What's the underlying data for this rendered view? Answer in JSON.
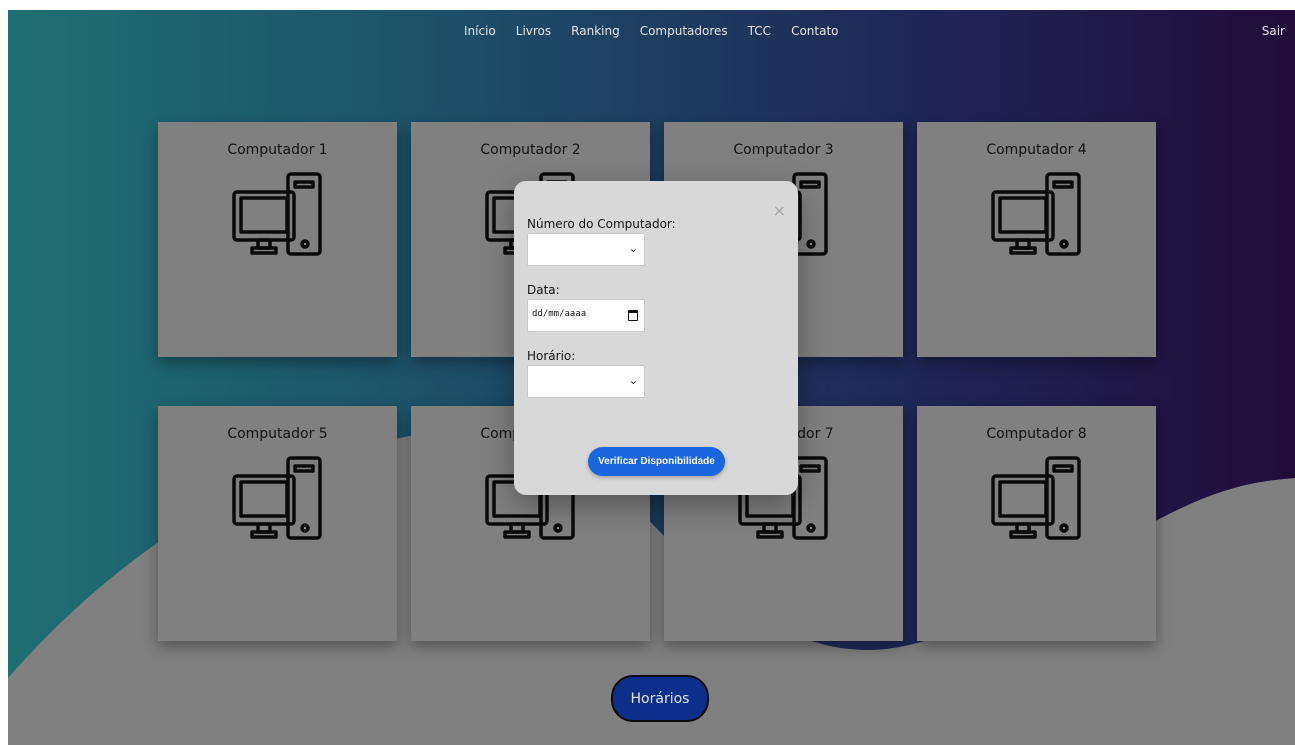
{
  "nav": {
    "items": [
      "Início",
      "Livros",
      "Ranking",
      "Computadores",
      "TCC",
      "Contato"
    ],
    "logout": "Sair"
  },
  "computers": [
    {
      "title": "Computador 1",
      "icon": "desktop-computer-icon"
    },
    {
      "title": "Computador 2",
      "icon": "desktop-computer-icon"
    },
    {
      "title": "Computador 3",
      "icon": "desktop-computer-icon"
    },
    {
      "title": "Computador 4",
      "icon": "desktop-computer-icon"
    },
    {
      "title": "Computador 5",
      "icon": "desktop-computer-icon"
    },
    {
      "title": "Computador 6",
      "icon": "desktop-computer-icon"
    },
    {
      "title": "Computador 7",
      "icon": "desktop-computer-icon"
    },
    {
      "title": "Computador 8",
      "icon": "desktop-computer-icon"
    }
  ],
  "horarios_button": "Horários",
  "modal": {
    "close_symbol": "×",
    "computer_label": "Número do Computador:",
    "computer_value": "",
    "date_label": "Data:",
    "date_placeholder": "dd/mm/aaaa",
    "time_label": "Horário:",
    "time_value": "",
    "verify_button": "Verificar Disponibilidade"
  },
  "colors": {
    "card_bg": "#808080",
    "modal_bg": "#d8d8d8",
    "verify_button": "#1a66e0",
    "horarios_button": "#0b2f8a",
    "bg_left": "#1e6f72",
    "bg_right": "#210c3a",
    "wave": "#808080"
  }
}
